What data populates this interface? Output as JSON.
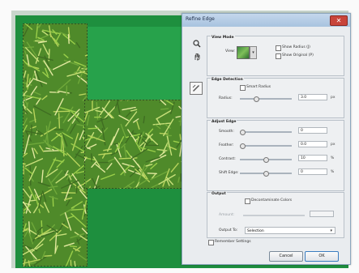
{
  "dialog": {
    "title": "Refine Edge",
    "close_glyph": "✕",
    "view_mode": {
      "title": "View Mode",
      "view_label": "View:",
      "show_radius": "Show Radius (J)",
      "show_original": "Show Original (P)"
    },
    "edge_detection": {
      "title": "Edge Detection",
      "smart_radius": "Smart Radius",
      "radius_label": "Radius:",
      "radius_value": "3.0",
      "radius_unit": "px",
      "radius_level": 0.3
    },
    "adjust_edge": {
      "title": "Adjust Edge",
      "smooth_label": "Smooth:",
      "smooth_value": "0",
      "smooth_level": 0,
      "feather_label": "Feather:",
      "feather_value": "0.0",
      "feather_unit": "px",
      "feather_level": 0,
      "contrast_label": "Contrast:",
      "contrast_value": "10",
      "contrast_unit": "%",
      "contrast_level": 0.5,
      "shift_label": "Shift Edge:",
      "shift_value": "0",
      "shift_unit": "%",
      "shift_level": 0.5
    },
    "output": {
      "title": "Output",
      "decontaminate": "Decontaminate Colors",
      "amount_label": "Amount:",
      "output_to_label": "Output To:",
      "output_to_value": "Selection"
    },
    "remember": "Remember Settings",
    "cancel": "Cancel",
    "ok": "OK"
  },
  "icons": {
    "zoom": "zoom-icon",
    "hand": "hand-icon",
    "radius_tool": "refine-radius-icon"
  },
  "colors": {
    "green_background": "#1e8f3e",
    "dialog_bg": "#e9ecef",
    "ok_border": "#3a7cc0"
  }
}
